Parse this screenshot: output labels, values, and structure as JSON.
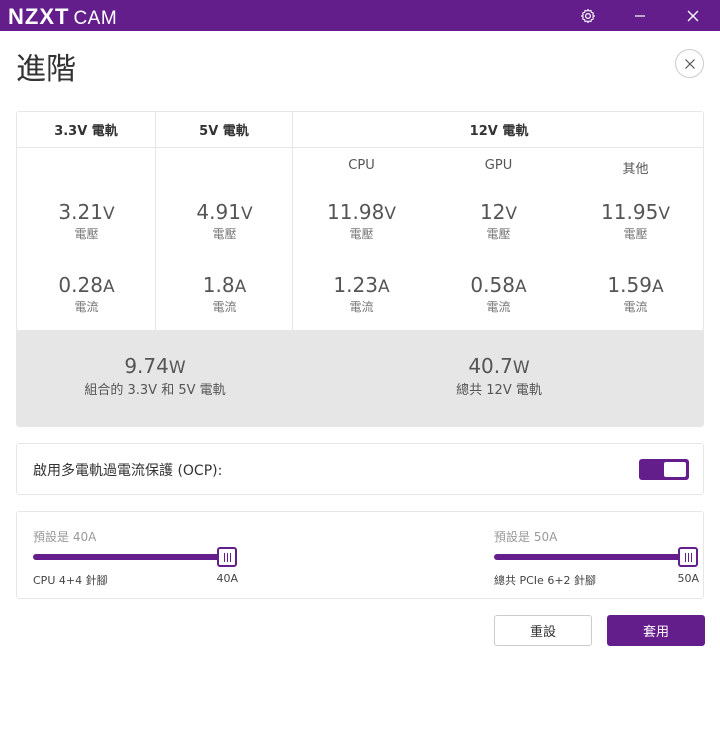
{
  "app": {
    "brand": "NZXT",
    "app_name": "CAM",
    "accent_color": "#641e8c"
  },
  "titlebar": {
    "settings_icon": "gear-icon",
    "minimize_icon": "minimize-icon",
    "close_icon": "close-icon"
  },
  "page": {
    "title": "進階",
    "close_icon": "close-icon"
  },
  "rails": {
    "rail_33": {
      "header": "3.3V 電軌",
      "voltage": "3.21",
      "voltage_unit": "V",
      "voltage_caption": "電壓",
      "current": "0.28",
      "current_unit": "A",
      "current_caption": "電流"
    },
    "rail_5": {
      "header": "5V 電軌",
      "voltage": "4.91",
      "voltage_unit": "V",
      "voltage_caption": "電壓",
      "current": "1.8",
      "current_unit": "A",
      "current_caption": "電流"
    },
    "rail_12": {
      "header": "12V 電軌",
      "subs": [
        {
          "label": "CPU",
          "voltage": "11.98",
          "voltage_unit": "V",
          "voltage_caption": "電壓",
          "current": "1.23",
          "current_unit": "A",
          "current_caption": "電流"
        },
        {
          "label": "GPU",
          "voltage": "12",
          "voltage_unit": "V",
          "voltage_caption": "電壓",
          "current": "0.58",
          "current_unit": "A",
          "current_caption": "電流"
        },
        {
          "label": "其他",
          "voltage": "11.95",
          "voltage_unit": "V",
          "voltage_caption": "電壓",
          "current": "1.59",
          "current_unit": "A",
          "current_caption": "電流"
        }
      ]
    },
    "totals": {
      "combined": {
        "value": "9.74",
        "unit": "W",
        "caption": "組合的 3.3V 和 5V 電軌"
      },
      "total_12v": {
        "value": "40.7",
        "unit": "W",
        "caption": "總共 12V 電軌"
      }
    }
  },
  "ocp": {
    "label": "啟用多電軌過電流保護 (OCP):",
    "enabled": true
  },
  "sliders": [
    {
      "default_label": "預設是 40A",
      "name": "CPU 4+4 針腳",
      "value_label": "40A",
      "level_percent": 100
    },
    {
      "default_label": "預設是 50A",
      "name": "總共 PCIe 6+2 針腳",
      "value_label": "50A",
      "level_percent": 100
    }
  ],
  "buttons": {
    "reset": "重設",
    "apply": "套用"
  }
}
